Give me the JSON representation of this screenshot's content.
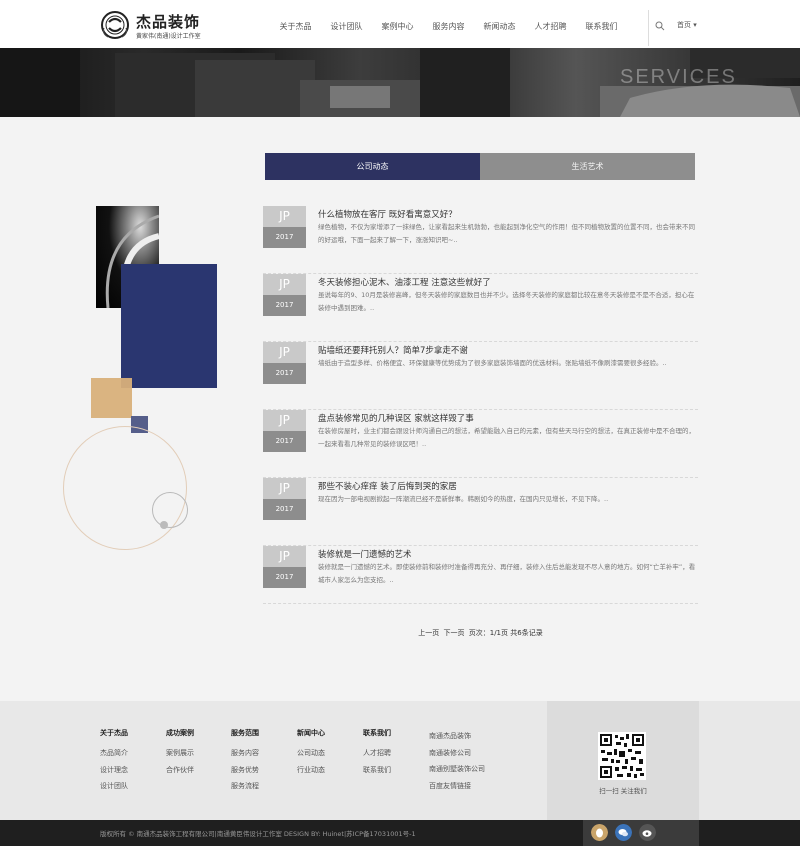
{
  "header": {
    "logo_title": "杰品装饰",
    "logo_subtitle": "黄家伟(南通)设计工作室",
    "nav": [
      "关于杰品",
      "设计团队",
      "案例中心",
      "服务内容",
      "新闻动态",
      "人才招聘",
      "联系我们"
    ],
    "home_select": "首页 ▾"
  },
  "banner": {
    "text": "SERVICES"
  },
  "tabs": [
    {
      "label": "公司动态",
      "active": true
    },
    {
      "label": "生活艺术",
      "active": false
    }
  ],
  "news": [
    {
      "badge": "JP",
      "year": "2017",
      "title": "什么植物放在客厅 既好看寓意又好？",
      "desc": "绿色植物，不仅为家增添了一抹绿色，让家看起来生机勃勃，也能起到净化空气的作用！但不同植物放置的位置不同，也会带来不同的好运哦，下面一起来了解一下，涨涨知识吧~.."
    },
    {
      "badge": "JP",
      "year": "2017",
      "title": "冬天装修担心泥木、油漆工程 注意这些就好了",
      "desc": "虽说每年的9、10月是装修高峰，但冬天装修的家庭数目也并不少。选择冬天装修的家庭都比较在意冬天装修是不是不合适，担心在装修中遇到困难。.."
    },
    {
      "badge": "JP",
      "year": "2017",
      "title": "贴墙纸还要拜托别人？简单7步拿走不谢",
      "desc": "墙纸由于造型多样、价格便宜、环保健康等优势成为了很多家庭装饰墙面的优选材料。张贴墙纸不像刷漆需要很多经验。.."
    },
    {
      "badge": "JP",
      "year": "2017",
      "title": "盘点装修常见的几种误区 家就这样毁了事",
      "desc": "在装修房屋时，业主们都会跟设计师沟通自己的想法，希望能融入自己的元素，但有些天马行空的想法，在真正装修中是不合理的，一起来看看几种常见的装修误区吧！.."
    },
    {
      "badge": "JP",
      "year": "2017",
      "title": "那些不装心痒痒 装了后悔到哭的家居",
      "desc": "现在因为一部电视剧掀起一阵潮流已经不是新鲜事。韩剧如今的热度，在国内只见增长，不见下降。.."
    },
    {
      "badge": "JP",
      "year": "2017",
      "title": "装修就是一门遗憾的艺术",
      "desc": "装修就是一门遗憾的艺术。即使装修前和装修时准备得再充分、再仔细，装修入住后总能发现不尽人意的地方。如何“亡羊补牢”，看城市人家怎么为您支招。.."
    }
  ],
  "pagination": {
    "prev": "上一页",
    "next": "下一页",
    "info": "页次：1/1页 共6条记录"
  },
  "footer": {
    "columns": [
      {
        "title": "关于杰品",
        "items": [
          "杰品简介",
          "设计理念",
          "设计团队"
        ]
      },
      {
        "title": "成功案例",
        "items": [
          "案例展示",
          "合作伙伴"
        ]
      },
      {
        "title": "服务范围",
        "items": [
          "服务内容",
          "服务优势",
          "服务流程"
        ]
      },
      {
        "title": "新闻中心",
        "items": [
          "公司动态",
          "行业动态"
        ]
      },
      {
        "title": "联系我们",
        "items": [
          "人才招聘",
          "联系我们"
        ]
      },
      {
        "title": "",
        "items": [
          "南通杰品装饰",
          "南通装修公司",
          "南通别墅装饰公司",
          "百度友情链接"
        ]
      }
    ],
    "qr_label": "扫一扫 关注我们",
    "copyright": "版权所有 © 南通杰品装饰工程有限公司|南通黄臣伟设计工作室 DESIGN BY: Huinet|苏ICP备17031001号-1"
  },
  "colors": {
    "accent": "#2d3261",
    "tab_inactive": "#8e8e8e",
    "footer_bg": "#e8e8e8",
    "bottom_bar": "#1f1f1f"
  }
}
